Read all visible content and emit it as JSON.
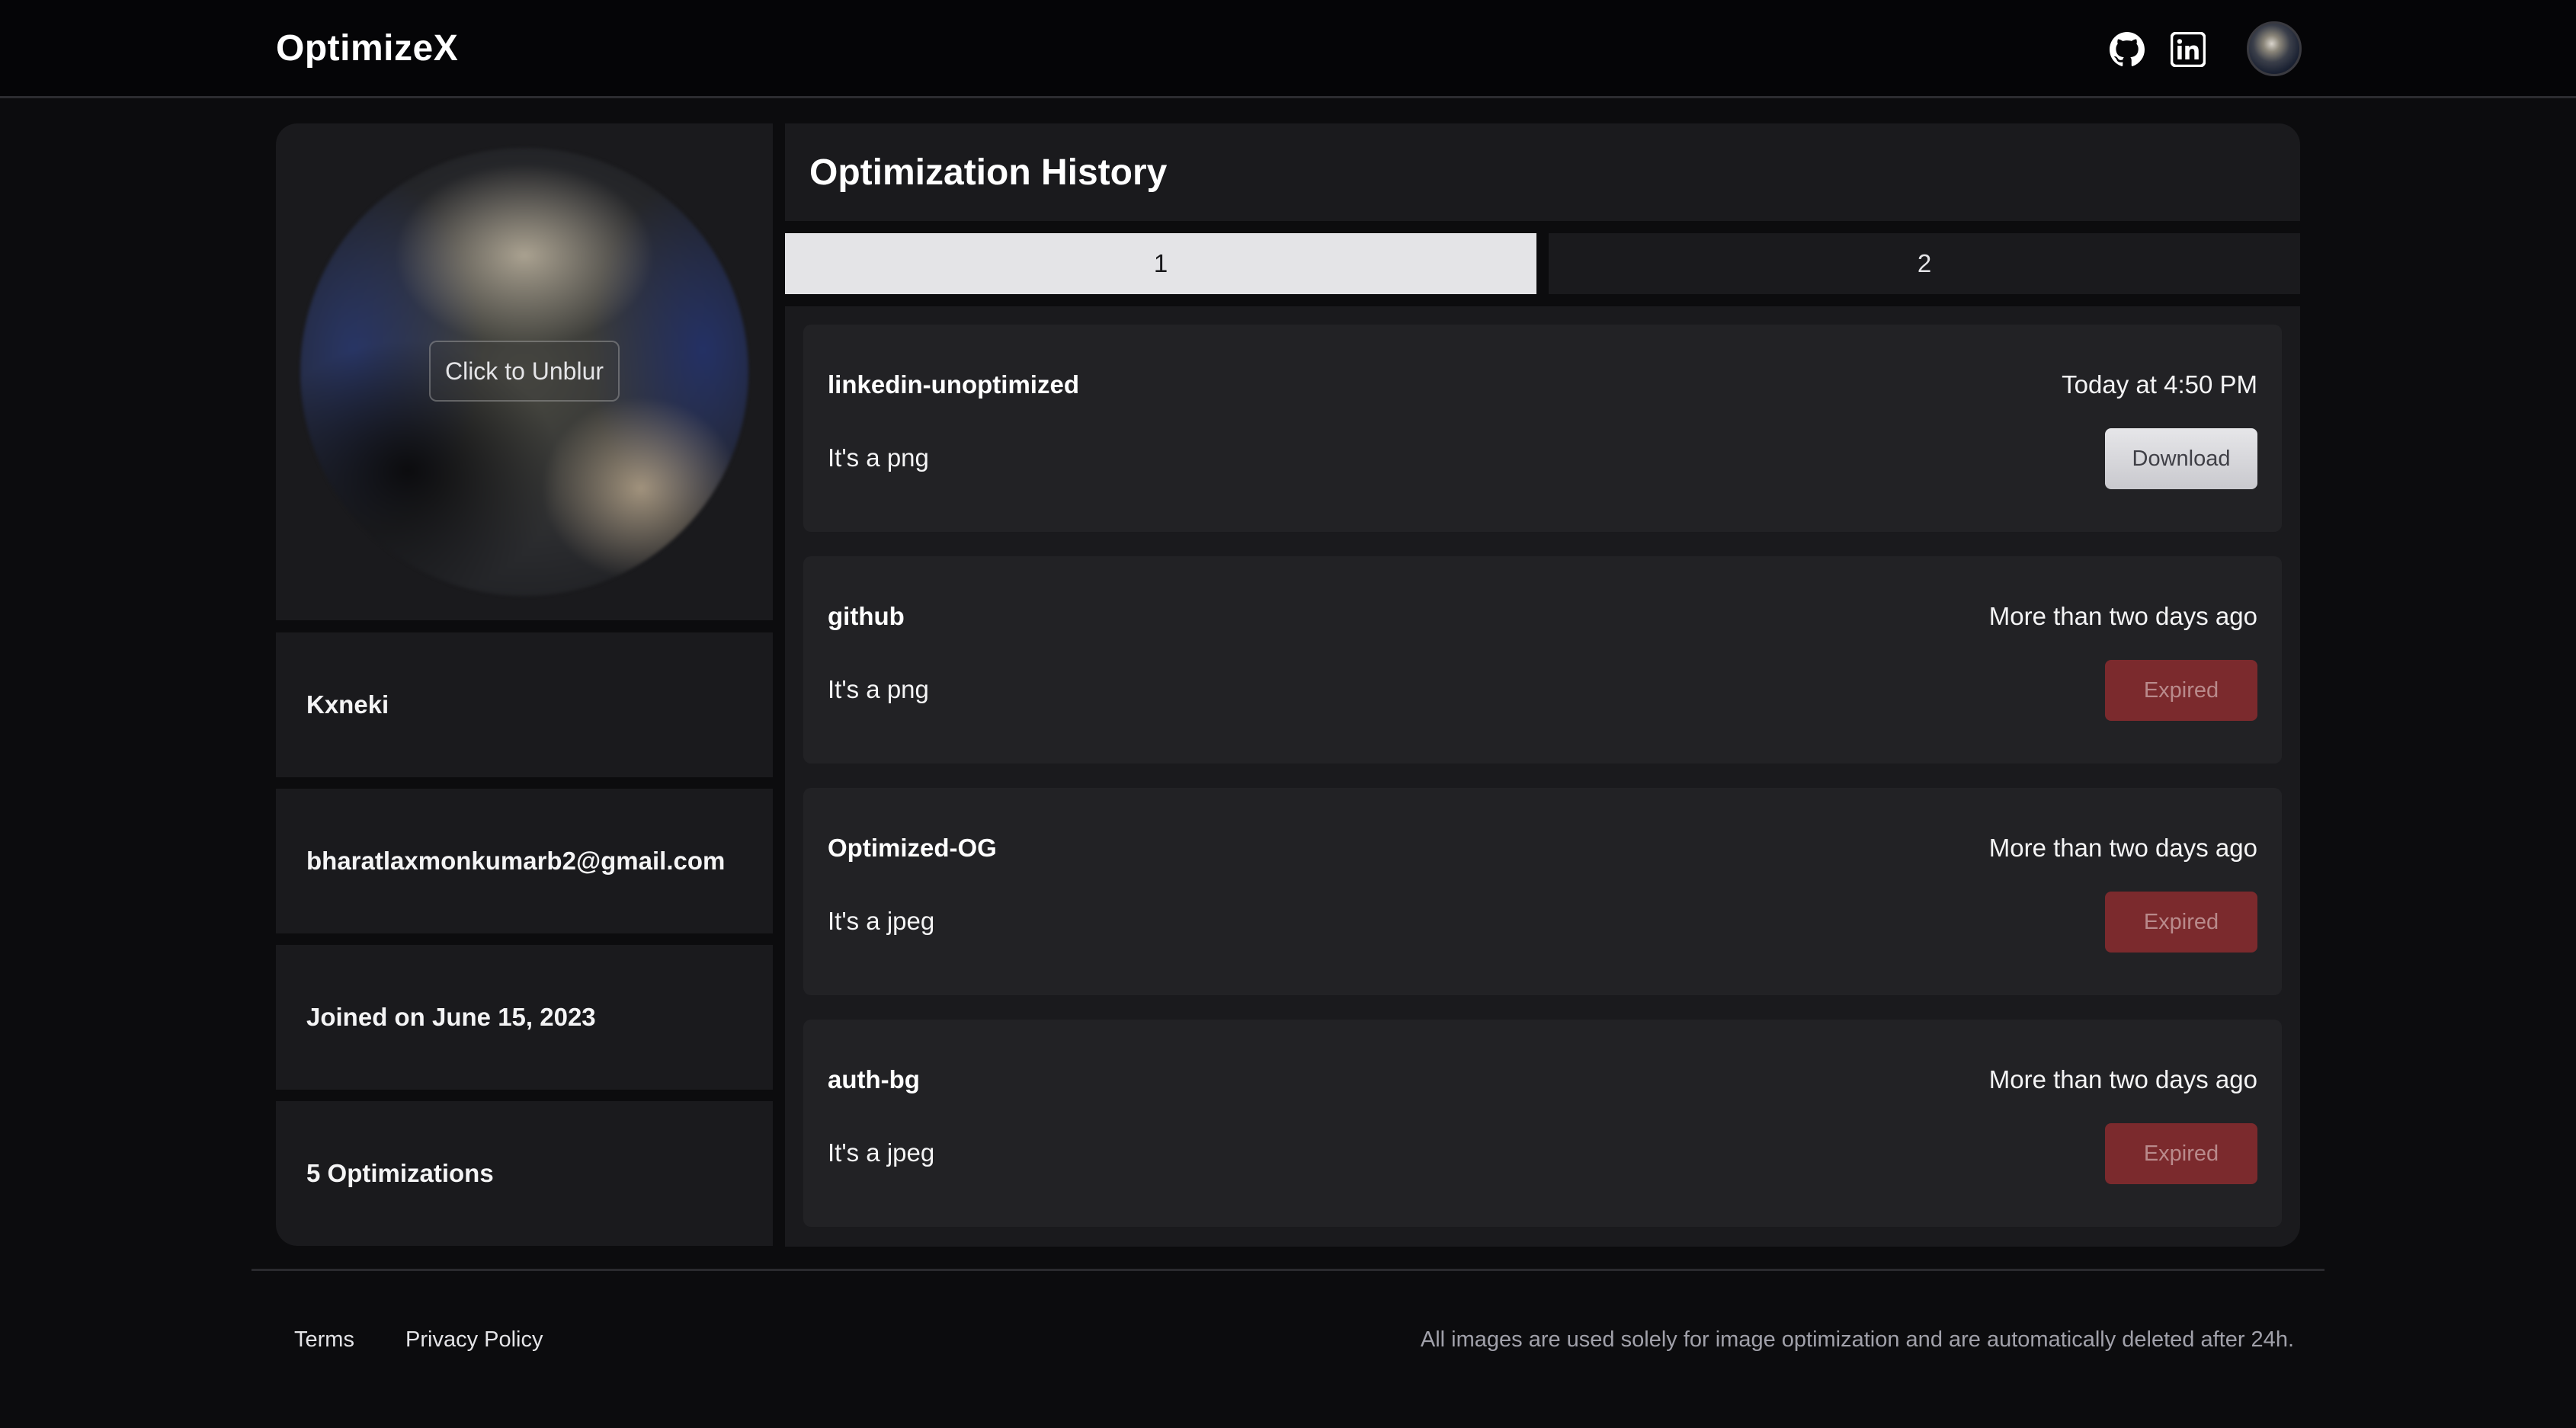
{
  "header": {
    "brand": "OptimizeX",
    "icons": [
      "github-icon",
      "linkedin-icon"
    ]
  },
  "profile": {
    "unblur_label": "Click to Unblur",
    "username": "Kxneki",
    "email": "bharatlaxmonkumarb2@gmail.com",
    "joined": "Joined on June 15, 2023",
    "optimizations": "5 Optimizations"
  },
  "history": {
    "title": "Optimization History",
    "tabs": [
      "1",
      "2"
    ],
    "active_tab": "1",
    "items": [
      {
        "name": "linkedin-unoptimized",
        "time": "Today at 4:50 PM",
        "type": "It's a png",
        "action": "Download"
      },
      {
        "name": "github",
        "time": "More than two days ago",
        "type": "It's a png",
        "action": "Expired"
      },
      {
        "name": "Optimized-OG",
        "time": "More than two days ago",
        "type": "It's a jpeg",
        "action": "Expired"
      },
      {
        "name": "auth-bg",
        "time": "More than two days ago",
        "type": "It's a jpeg",
        "action": "Expired"
      }
    ]
  },
  "footer": {
    "terms": "Terms",
    "privacy": "Privacy Policy",
    "note": "All images are used solely for image optimization and are automatically deleted after 24h."
  },
  "colors": {
    "background": "#0c0c0e",
    "card": "#1a1a1d",
    "item": "#222225",
    "active_tab": "#e4e4e7",
    "expired": "#7b2a2d"
  }
}
